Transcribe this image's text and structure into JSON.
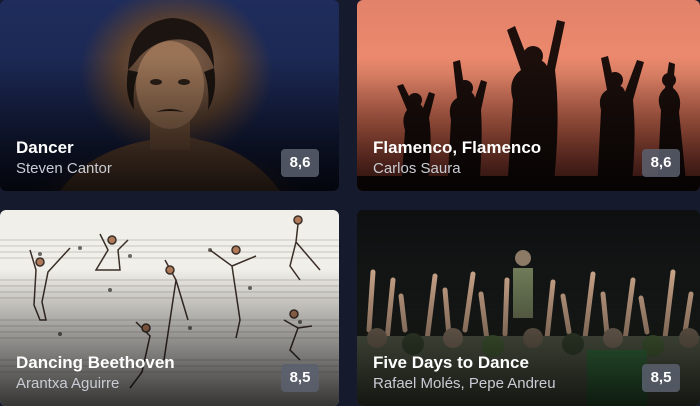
{
  "cards": [
    {
      "title": "Dancer",
      "subtitle": "Steven Cantor",
      "rating": "8,6",
      "image": "portrait-of-dancer"
    },
    {
      "title": "Flamenco, Flamenco",
      "subtitle": "Carlos Saura",
      "rating": "8,6",
      "image": "flamenco-silhouettes"
    },
    {
      "title": "Dancing Beethoven",
      "subtitle": "Arantxa Aguirre",
      "rating": "8,5",
      "image": "dancers-on-score"
    },
    {
      "title": "Five Days to Dance",
      "subtitle": "Rafael Molés, Pepe Andreu",
      "rating": "8,5",
      "image": "crowd-raised-hands"
    }
  ],
  "colors": {
    "page_background": "#151a2d",
    "rating_badge": "#5a606e",
    "title_text": "#ffffff",
    "subtitle_text": "#c9ccd4"
  }
}
